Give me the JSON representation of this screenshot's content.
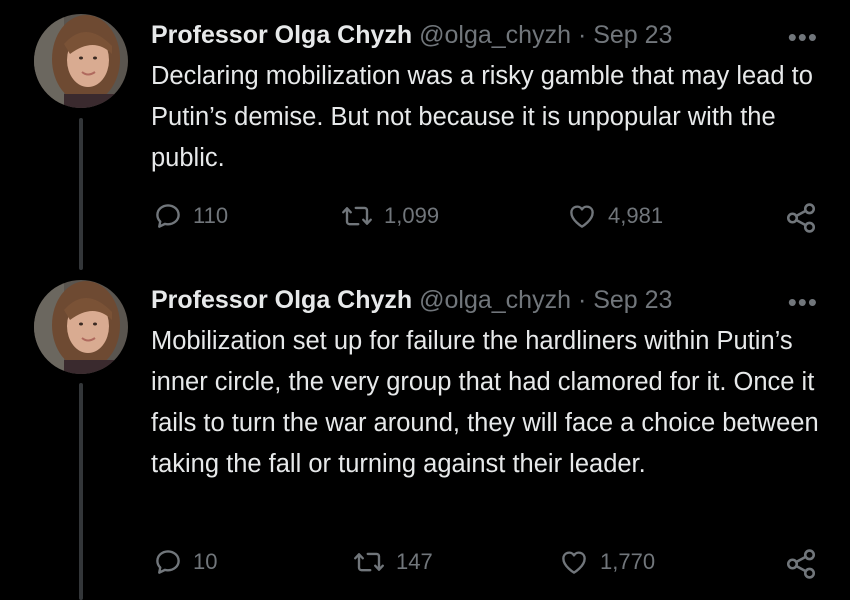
{
  "tweets": [
    {
      "author_name": "Professor Olga Chyzh",
      "handle": "@olga_chyzh",
      "separator": "·",
      "date": "Sep 23",
      "more": "•••",
      "text": "Declaring mobilization was a risky gamble that may lead to Putin’s demise. But not because it is unpopular with the public.",
      "replies": "110",
      "retweets": "1,099",
      "likes": "4,981",
      "icons": [
        "reply-icon",
        "retweet-icon",
        "like-icon",
        "share-icon"
      ]
    },
    {
      "author_name": "Professor Olga Chyzh",
      "handle": "@olga_chyzh",
      "separator": "·",
      "date": "Sep 23",
      "more": "•••",
      "text": "Mobilization set up for failure the hardliners within Putin’s inner circle, the very group that had clamored for it. Once it fails to turn the war around, they will face a choice between taking the fall or turning against their leader.",
      "replies": "10",
      "retweets": "147",
      "likes": "1,770",
      "icons": [
        "reply-icon",
        "retweet-icon",
        "like-icon",
        "share-icon"
      ]
    }
  ],
  "colors": {
    "background": "#000000",
    "text_primary": "#e7e9ea",
    "text_secondary": "#71767b",
    "thread_line": "#333639"
  }
}
